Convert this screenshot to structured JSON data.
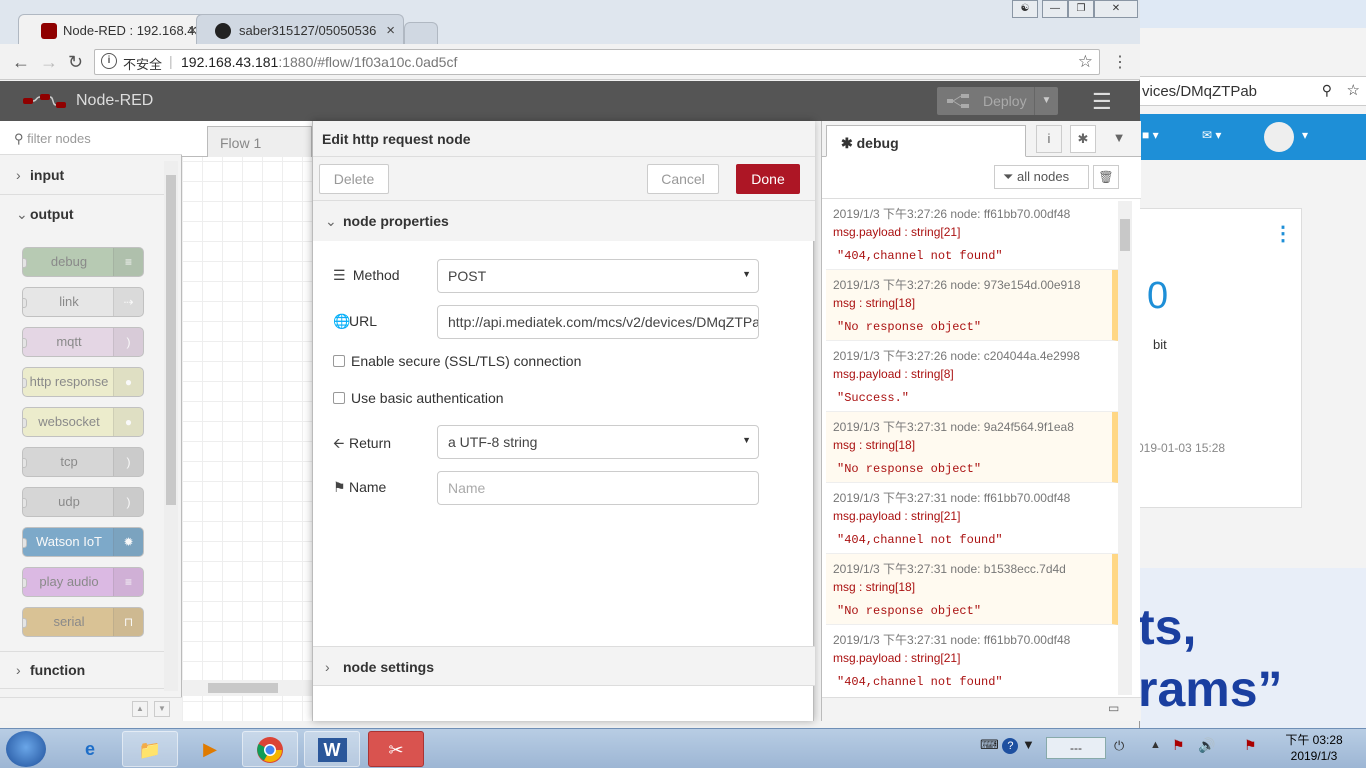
{
  "browser": {
    "tabs": [
      {
        "title": "Node-RED : 192.168.43.",
        "close": "×",
        "active": true
      },
      {
        "title": "saber315127/05050536",
        "close": "×",
        "active": false
      }
    ],
    "url": {
      "insecure_label": "不安全",
      "host": "192.168.43.181",
      "path": ":1880/#flow/1f03a10c.0ad5cf"
    }
  },
  "header": {
    "app_name": "Node-RED",
    "deploy_label": "Deploy"
  },
  "palette": {
    "search_placeholder": "filter nodes",
    "categories": [
      {
        "label": "input"
      },
      {
        "label": "output"
      },
      {
        "label": "function"
      }
    ],
    "nodes": [
      {
        "label": "debug",
        "color": "#87a980"
      },
      {
        "label": "link",
        "color": "#dddddd"
      },
      {
        "label": "mqtt",
        "color": "#d8bfd8"
      },
      {
        "label": "http response",
        "color": "#e7e7ae"
      },
      {
        "label": "websocket",
        "color": "#e7e7ae"
      },
      {
        "label": "tcp",
        "color": "#c0c0c0"
      },
      {
        "label": "udp",
        "color": "#c0c0c0"
      },
      {
        "label": "Watson IoT",
        "color": "#1e6ea7"
      },
      {
        "label": "play audio",
        "color": "#c98ad6"
      },
      {
        "label": "serial",
        "color": "#c59b4a"
      }
    ]
  },
  "workspace": {
    "tab_label": "Flow 1"
  },
  "editor": {
    "title": "Edit http request node",
    "delete_label": "Delete",
    "cancel_label": "Cancel",
    "done_label": "Done",
    "properties_header": "node properties",
    "settings_header": "node settings",
    "method_label": "Method",
    "method_value": "POST",
    "url_label": "URL",
    "url_value": "http://api.mediatek.com/mcs/v2/devices/DMqZTPa",
    "tls_label": "Enable secure (SSL/TLS) connection",
    "auth_label": "Use basic authentication",
    "return_label": "Return",
    "return_value": "a UTF-8 string",
    "name_label": "Name",
    "name_placeholder": "Name"
  },
  "sidebar": {
    "tab_label": "debug",
    "filter_label": "all nodes",
    "messages": [
      {
        "meta": "2019/1/3 下午3:27:26   node: ff61bb70.00df48",
        "topic": "msg.payload : string[21]",
        "value": "\"404,channel not found\"",
        "warn": false
      },
      {
        "meta": "2019/1/3 下午3:27:26   node: 973e154d.00e918",
        "topic": "msg : string[18]",
        "value": "\"No response object\"",
        "warn": true
      },
      {
        "meta": "2019/1/3 下午3:27:26   node: c204044a.4e2998",
        "topic": "msg.payload : string[8]",
        "value": "\"Success.\"",
        "warn": false
      },
      {
        "meta": "2019/1/3 下午3:27:31   node: 9a24f564.9f1ea8",
        "topic": "msg : string[18]",
        "value": "\"No response object\"",
        "warn": true
      },
      {
        "meta": "2019/1/3 下午3:27:31   node: ff61bb70.00df48",
        "topic": "msg.payload : string[21]",
        "value": "\"404,channel not found\"",
        "warn": false
      },
      {
        "meta": "2019/1/3 下午3:27:31   node: b1538ecc.7d4d",
        "topic": "msg : string[18]",
        "value": "\"No response object\"",
        "warn": true
      },
      {
        "meta": "2019/1/3 下午3:27:31   node: ff61bb70.00df48",
        "topic": "msg.payload : string[21]",
        "value": "\"404,channel not found\"",
        "warn": false
      }
    ]
  },
  "background_window": {
    "address_fragment": "vices/DMqZTPab",
    "value": "0",
    "unit": "bit",
    "timestamp": "019-01-03 15:28",
    "banner_line1": "ts,",
    "banner_line2": "rams”"
  },
  "taskbar": {
    "time": "下午 03:28",
    "date": "2019/1/3",
    "tray_box": "---"
  },
  "colors": {
    "header_bg": "#555555",
    "done_button": "#ad1625",
    "warn_stripe": "#ffd785"
  }
}
